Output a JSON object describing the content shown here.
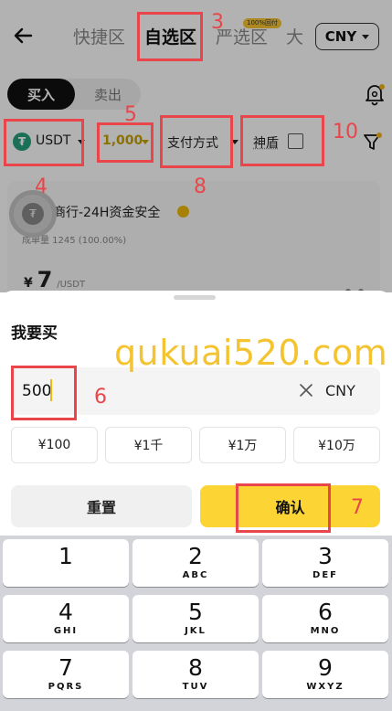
{
  "header": {
    "tabs": [
      {
        "label": "快捷区",
        "active": false
      },
      {
        "label": "自选区",
        "active": true
      },
      {
        "label": "严选区",
        "active": false,
        "badge": "100%回付"
      },
      {
        "label": "大",
        "active": false
      }
    ],
    "currency": "CNY"
  },
  "trade_toggle": {
    "buy": "买入",
    "sell": "卖出"
  },
  "filters": {
    "coin": "USDT",
    "amount": "1,000",
    "payment": "支付方式",
    "shield": "神盾"
  },
  "merchant": {
    "name": "祥瑞商行-24H资金安全",
    "stats": "成单量 1245 (100.00%)",
    "price_symbol": "¥",
    "price": "7",
    "price_unit": "/USDT"
  },
  "sheet": {
    "title": "我要买",
    "input_value": "500",
    "input_currency": "CNY",
    "quick_amounts": [
      "¥100",
      "¥1千",
      "¥1万",
      "¥10万"
    ],
    "reset": "重置",
    "confirm": "确认"
  },
  "watermark": "qukuai520.com",
  "annotations": [
    "3",
    "4",
    "5",
    "6",
    "7",
    "8",
    "10"
  ],
  "keypad": [
    {
      "digit": "1",
      "letters": ""
    },
    {
      "digit": "2",
      "letters": "ABC"
    },
    {
      "digit": "3",
      "letters": "DEF"
    },
    {
      "digit": "4",
      "letters": "GHI"
    },
    {
      "digit": "5",
      "letters": "JKL"
    },
    {
      "digit": "6",
      "letters": "MNO"
    },
    {
      "digit": "7",
      "letters": "PQRS"
    },
    {
      "digit": "8",
      "letters": "TUV"
    },
    {
      "digit": "9",
      "letters": "WXYZ"
    }
  ],
  "colors": {
    "accent": "#fcd535",
    "annotation": "#e8464a",
    "watermark": "#f4c330"
  }
}
